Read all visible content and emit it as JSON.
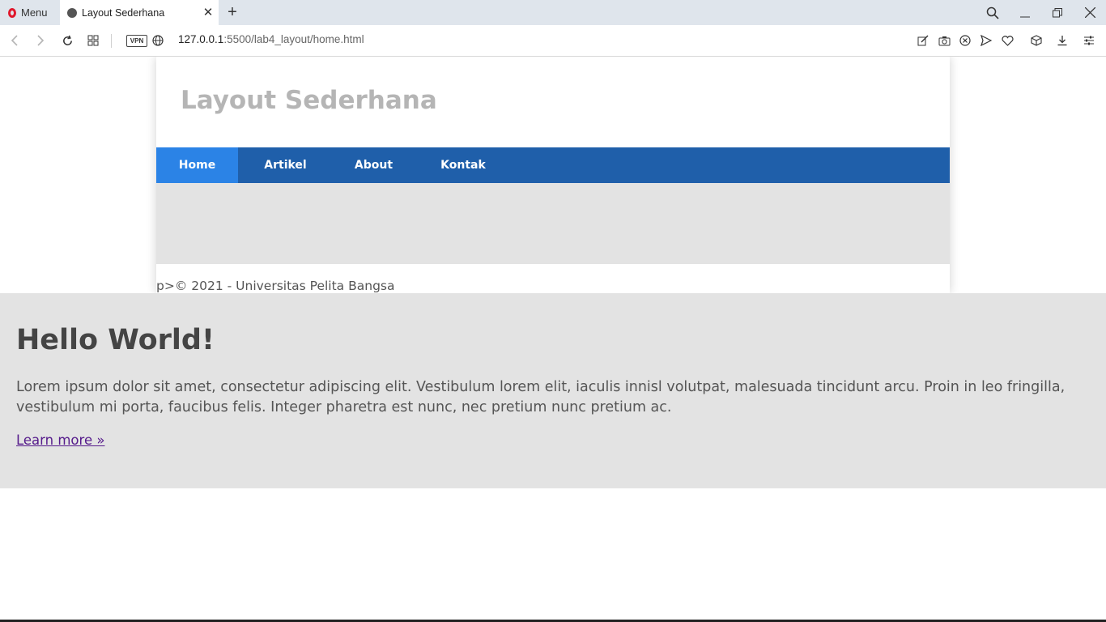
{
  "browser": {
    "menu_label": "Menu",
    "tab_title": "Layout Sederhana",
    "url_host": "127.0.0.1",
    "url_rest": ":5500/lab4_layout/home.html",
    "vpn_label": "VPN",
    "icons": [
      "back-icon",
      "forward-icon",
      "reload-icon",
      "speed-dial-icon",
      "globe-icon",
      "edit-icon",
      "camera-icon",
      "block-icon",
      "send-icon",
      "heart-icon",
      "cube-icon",
      "download-icon",
      "settings-icon",
      "search-icon",
      "minimize-icon",
      "restore-icon",
      "close-icon"
    ]
  },
  "page": {
    "site_title": "Layout Sederhana",
    "nav": [
      {
        "label": "Home",
        "active": true
      },
      {
        "label": "Artikel",
        "active": false
      },
      {
        "label": "About",
        "active": false
      },
      {
        "label": "Kontak",
        "active": false
      }
    ],
    "footer_text": "p>© 2021 - Universitas Pelita Bangsa",
    "jumbotron": {
      "title": "Hello World!",
      "text": "Lorem ipsum dolor sit amet, consectetur adipiscing elit. Vestibulum lorem elit, iaculis innisl volutpat, malesuada tincidunt arcu. Proin in leo fringilla, vestibulum mi porta, faucibus felis. Integer pharetra est nunc, nec pretium nunc pretium ac.",
      "link": "Learn more »"
    }
  },
  "colors": {
    "nav_bg": "#1f5faa",
    "nav_active": "#2b83e6",
    "band_bg": "#e3e3e3",
    "title_color": "#b5b5b5"
  }
}
